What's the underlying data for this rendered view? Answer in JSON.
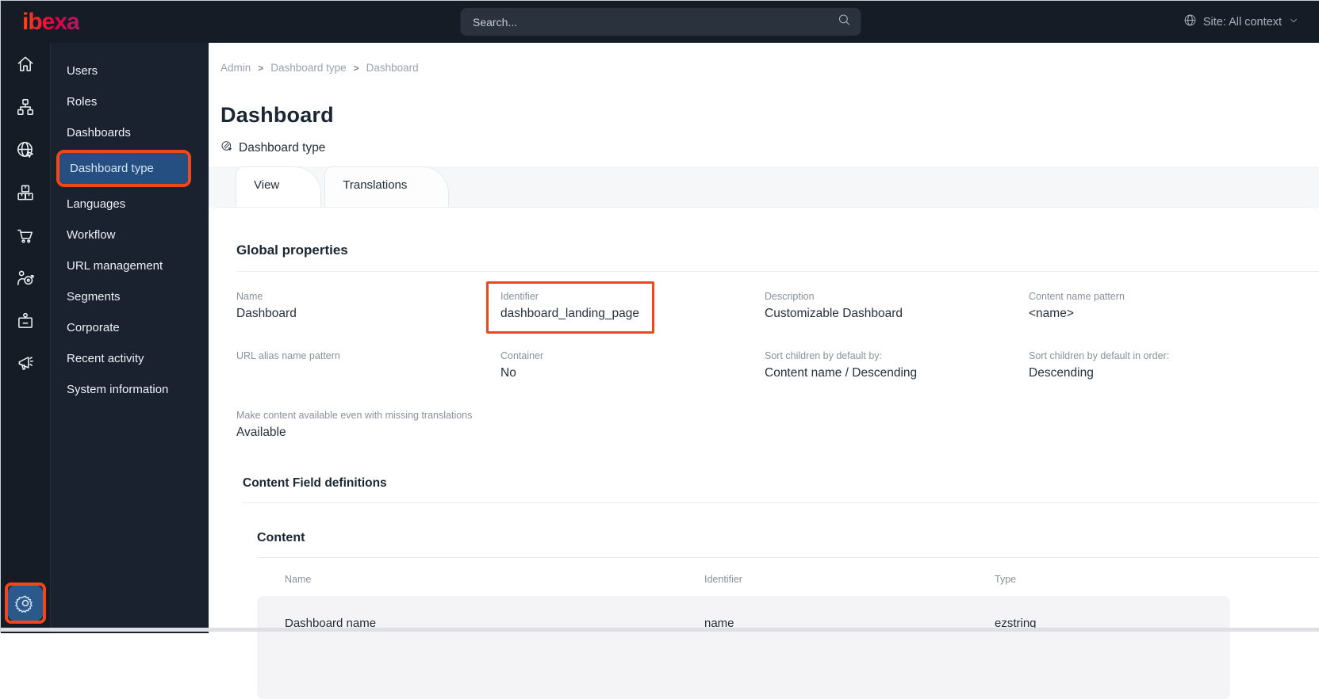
{
  "topbar": {
    "logo": "ibexa",
    "search_placeholder": "Search...",
    "site_context": "Site: All context"
  },
  "icon_rail": {
    "items": [
      "dashboard-home",
      "content-structure",
      "site",
      "product-catalog",
      "commerce",
      "personalization",
      "customer-portal",
      "activity"
    ],
    "bottom": "admin-settings"
  },
  "sidebar": {
    "items": [
      {
        "label": "Users",
        "selected": false
      },
      {
        "label": "Roles",
        "selected": false
      },
      {
        "label": "Dashboards",
        "selected": false
      },
      {
        "label": "Dashboard type",
        "selected": true
      },
      {
        "label": "Languages",
        "selected": false
      },
      {
        "label": "Workflow",
        "selected": false
      },
      {
        "label": "URL management",
        "selected": false
      },
      {
        "label": "Segments",
        "selected": false
      },
      {
        "label": "Corporate",
        "selected": false
      },
      {
        "label": "Recent activity",
        "selected": false
      },
      {
        "label": "System information",
        "selected": false
      }
    ]
  },
  "breadcrumb": {
    "separator": ">",
    "items": [
      "Admin",
      "Dashboard type",
      "Dashboard"
    ]
  },
  "page": {
    "title": "Dashboard",
    "subtitle": "Dashboard type"
  },
  "tabs": [
    {
      "label": "View",
      "active": true
    },
    {
      "label": "Translations",
      "active": false
    }
  ],
  "global_properties": {
    "heading": "Global properties",
    "fields": [
      {
        "label": "Name",
        "value": "Dashboard",
        "highlighted": false
      },
      {
        "label": "Identifier",
        "value": "dashboard_landing_page",
        "highlighted": true
      },
      {
        "label": "Description",
        "value": "Customizable Dashboard",
        "highlighted": false
      },
      {
        "label": "Content name pattern",
        "value": "<name>",
        "highlighted": false
      },
      {
        "label": "URL alias name pattern",
        "value": "",
        "highlighted": false
      },
      {
        "label": "Container",
        "value": "No",
        "highlighted": false
      },
      {
        "label": "Sort children by default by:",
        "value": "Content name / Descending",
        "highlighted": false
      },
      {
        "label": "Sort children by default in order:",
        "value": "Descending",
        "highlighted": false
      },
      {
        "label": "Make content available even with missing translations",
        "value": "Available",
        "highlighted": false
      }
    ]
  },
  "content_field_definitions": {
    "heading": "Content Field definitions",
    "group_heading": "Content",
    "table": {
      "headers": [
        "Name",
        "Identifier",
        "Type"
      ],
      "rows": [
        {
          "name": "Dashboard name",
          "identifier": "name",
          "type": "ezstring"
        }
      ]
    }
  },
  "colors": {
    "annotation_orange": "#f0481c",
    "selected_blue": "#254f80",
    "topbar_dark": "#151c26",
    "accent_gradient_start": "#ff4713",
    "accent_gradient_end": "#a81c62"
  }
}
